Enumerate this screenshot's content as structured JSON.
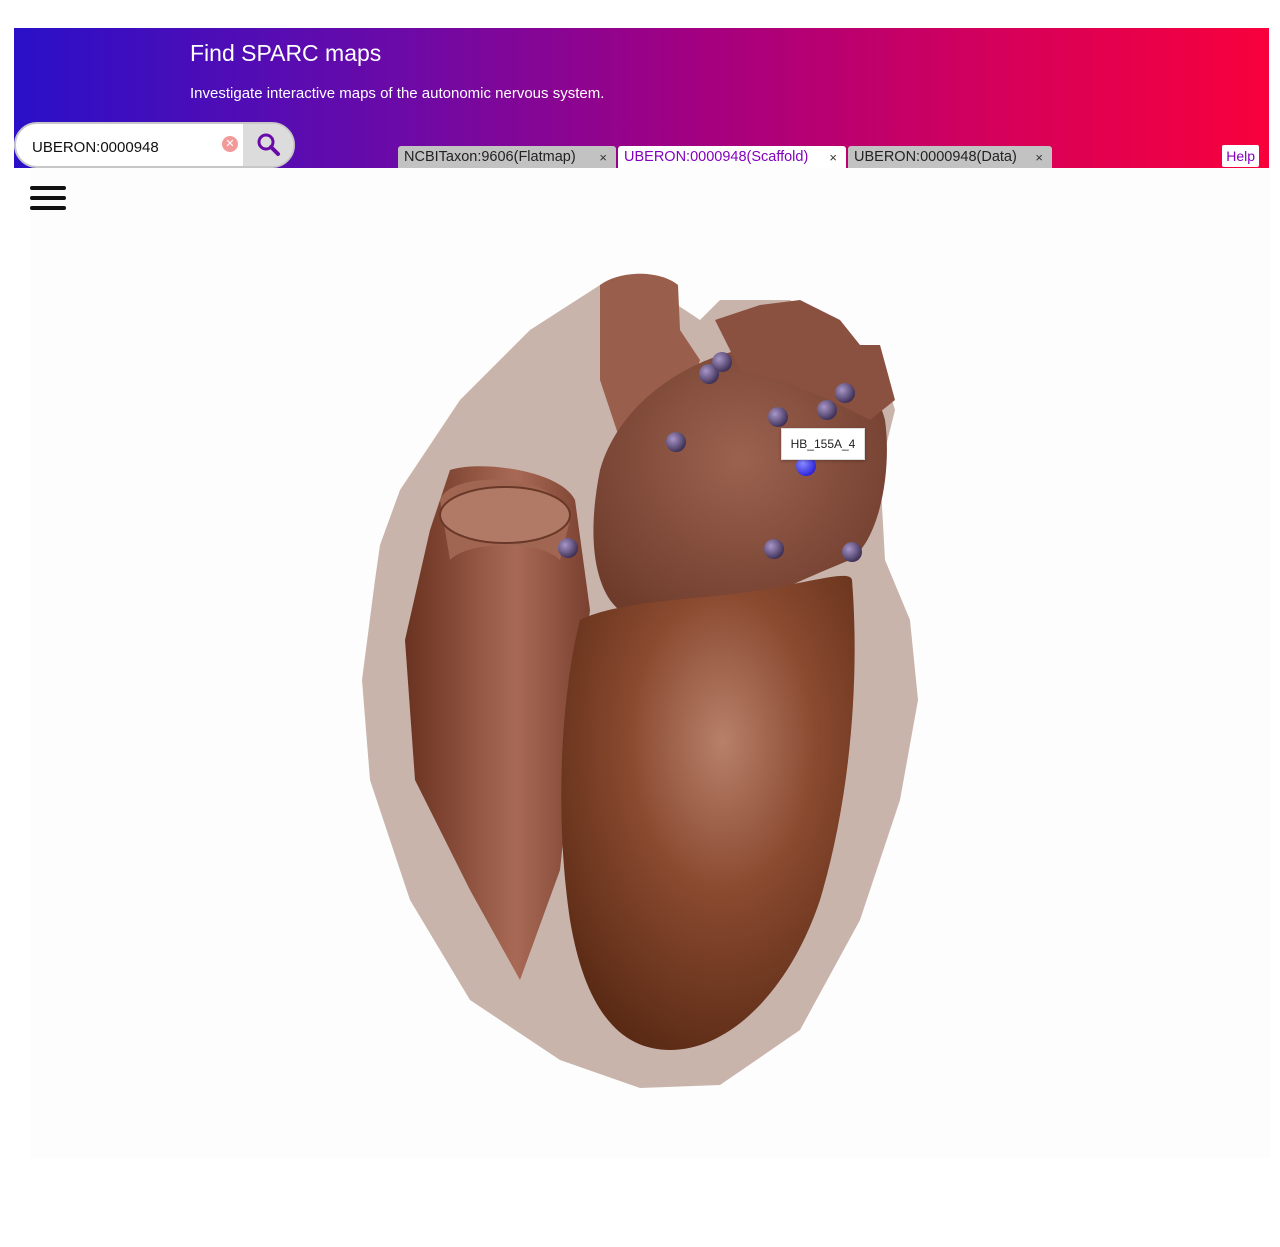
{
  "banner": {
    "title": "Find SPARC maps",
    "subtitle": "Investigate interactive maps of the autonomic nervous system."
  },
  "search": {
    "value": "UBERON:0000948",
    "clear_icon": "clear-icon",
    "search_icon": "search-icon"
  },
  "tabs": [
    {
      "label": "NCBITaxon:9606(Flatmap)",
      "close": "×",
      "active": false
    },
    {
      "label": "UBERON:0000948(Scaffold)",
      "close": "×",
      "active": true
    },
    {
      "label": "UBERON:0000948(Data)",
      "close": "×",
      "active": false
    }
  ],
  "help_label": "Help",
  "viewer": {
    "menu_icon": "hamburger-menu-icon",
    "tooltip": "HB_155A_4"
  },
  "colors": {
    "banner_start": "#2a10c8",
    "banner_end": "#f8003c",
    "accent": "#8300bf",
    "marker": "#4a3a66",
    "marker_selected": "#3a3aff"
  }
}
